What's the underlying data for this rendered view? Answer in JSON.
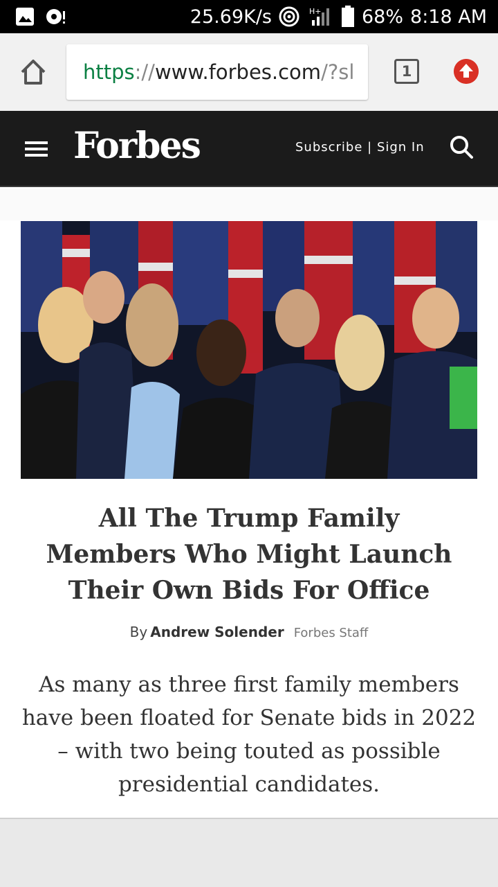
{
  "status_bar": {
    "network_speed": "25.69K/s",
    "network_type": "H+",
    "battery": "68%",
    "time": "8:18 AM",
    "icons": [
      "image-icon",
      "media-icon",
      "hotspot-icon",
      "signal-icon",
      "battery-icon"
    ]
  },
  "browser": {
    "url_scheme": "https",
    "url_sep": "://",
    "url_host": "www.forbes.com",
    "url_tail": "/?sl",
    "tab_count": "1"
  },
  "forbes": {
    "logo": "Forbes",
    "subscribe_signin": "Subscribe | Sign In"
  },
  "article": {
    "headline": "All The Trump Family Members Who Might Launch Their Own Bids For Office",
    "by_prefix": "By",
    "author": "Andrew Solender",
    "author_role": "Forbes Staff",
    "dek": "As many as three first family members have been floated for Senate bids in 2022 – with two being touted as possible presidential candidates."
  },
  "colors": {
    "forbes_header_bg": "#1b1b1b",
    "url_scheme_green": "#0b8043",
    "upload_red": "#d93025",
    "headline_text": "#333333"
  }
}
